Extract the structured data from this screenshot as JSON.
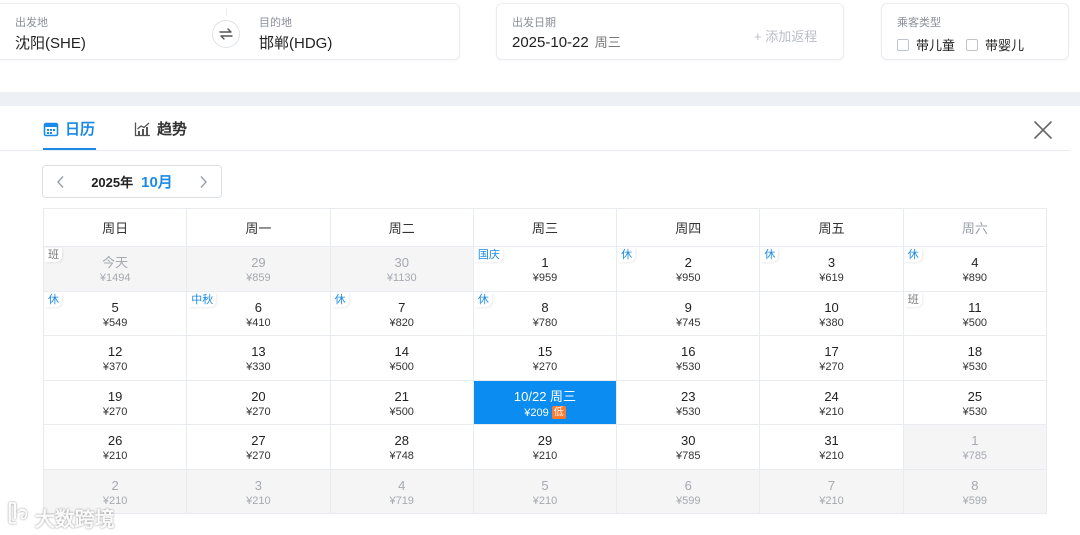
{
  "search": {
    "origin_label": "出发地",
    "origin_value": "沈阳(SHE)",
    "destination_label": "目的地",
    "destination_value": "邯郸(HDG)",
    "date_label": "出发日期",
    "date_value": "2025-10-22",
    "date_weekday": "周三",
    "add_return": "+ 添加返程",
    "passenger_label": "乘客类型",
    "with_child": "带儿童",
    "with_infant": "带婴儿"
  },
  "calendar": {
    "tab_calendar": "日历",
    "tab_trend": "趋势",
    "year": "2025年",
    "month": "10月",
    "weekdays": [
      "周日",
      "周一",
      "周二",
      "周三",
      "周四",
      "周五",
      "周六"
    ],
    "weeks": [
      [
        {
          "day": "今天",
          "price": "¥1494",
          "out": true,
          "tag": "班"
        },
        {
          "day": "29",
          "price": "¥859",
          "out": true
        },
        {
          "day": "30",
          "price": "¥1130",
          "out": true
        },
        {
          "day": "1",
          "price": "¥959",
          "tag": "国庆"
        },
        {
          "day": "2",
          "price": "¥950",
          "tag": "休"
        },
        {
          "day": "3",
          "price": "¥619",
          "tag": "休"
        },
        {
          "day": "4",
          "price": "¥890",
          "tag": "休"
        }
      ],
      [
        {
          "day": "5",
          "price": "¥549",
          "tag": "休"
        },
        {
          "day": "6",
          "price": "¥410",
          "tag": "中秋"
        },
        {
          "day": "7",
          "price": "¥820",
          "tag": "休"
        },
        {
          "day": "8",
          "price": "¥780",
          "tag": "休"
        },
        {
          "day": "9",
          "price": "¥745"
        },
        {
          "day": "10",
          "price": "¥380"
        },
        {
          "day": "11",
          "price": "¥500",
          "tag": "班"
        }
      ],
      [
        {
          "day": "12",
          "price": "¥370"
        },
        {
          "day": "13",
          "price": "¥330"
        },
        {
          "day": "14",
          "price": "¥500"
        },
        {
          "day": "15",
          "price": "¥270"
        },
        {
          "day": "16",
          "price": "¥530"
        },
        {
          "day": "17",
          "price": "¥270"
        },
        {
          "day": "18",
          "price": "¥530"
        }
      ],
      [
        {
          "day": "19",
          "price": "¥270"
        },
        {
          "day": "20",
          "price": "¥270"
        },
        {
          "day": "21",
          "price": "¥500"
        },
        {
          "day": "10/22 周三",
          "price": "¥209",
          "selected": true,
          "badge": "低"
        },
        {
          "day": "23",
          "price": "¥530"
        },
        {
          "day": "24",
          "price": "¥210"
        },
        {
          "day": "25",
          "price": "¥530"
        }
      ],
      [
        {
          "day": "26",
          "price": "¥210"
        },
        {
          "day": "27",
          "price": "¥270"
        },
        {
          "day": "28",
          "price": "¥748"
        },
        {
          "day": "29",
          "price": "¥210"
        },
        {
          "day": "30",
          "price": "¥785"
        },
        {
          "day": "31",
          "price": "¥210"
        },
        {
          "day": "1",
          "price": "¥785",
          "out": true
        }
      ],
      [
        {
          "day": "2",
          "price": "¥210",
          "out": true
        },
        {
          "day": "3",
          "price": "¥210",
          "out": true
        },
        {
          "day": "4",
          "price": "¥719",
          "out": true
        },
        {
          "day": "5",
          "price": "¥210",
          "out": true
        },
        {
          "day": "6",
          "price": "¥599",
          "out": true
        },
        {
          "day": "7",
          "price": "¥210",
          "out": true
        },
        {
          "day": "8",
          "price": "¥599",
          "out": true
        }
      ]
    ]
  },
  "watermark": "大数跨境",
  "colors": {
    "accent": "#1a8ae6",
    "selected": "#0a8cf0",
    "low_badge": "#ff7a2e"
  }
}
